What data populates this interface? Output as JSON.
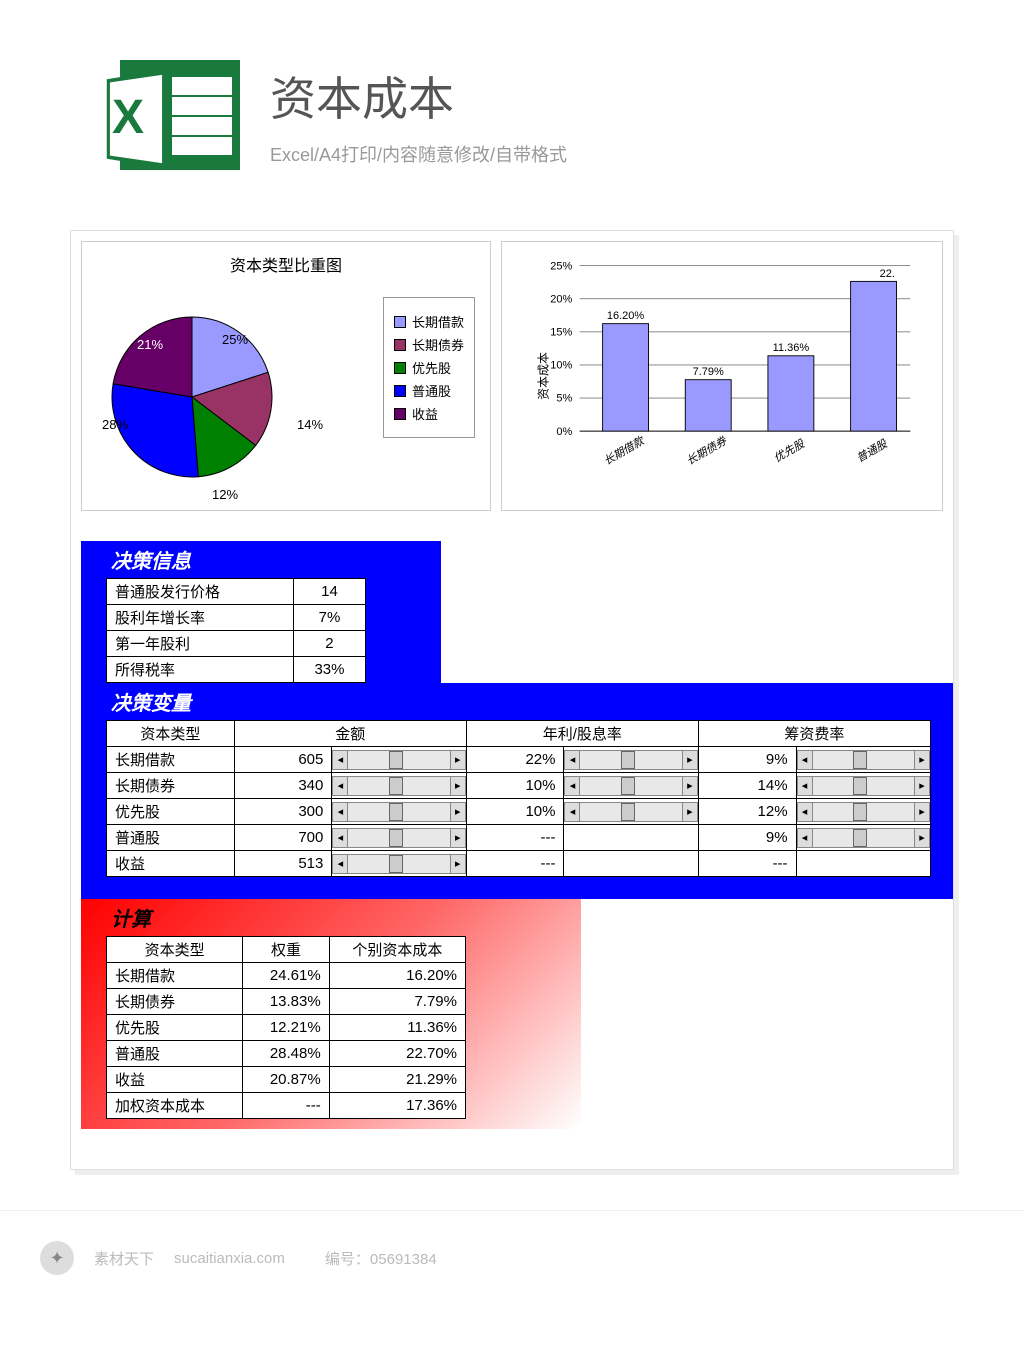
{
  "header": {
    "title": "资本成本",
    "subtitle": "Excel/A4打印/内容随意修改/自带格式"
  },
  "chart_data": [
    {
      "type": "pie",
      "title": "资本类型比重图",
      "series": [
        {
          "name": "长期借款",
          "value": 25,
          "color": "#9999ff"
        },
        {
          "name": "长期债券",
          "value": 14,
          "color": "#993366"
        },
        {
          "name": "优先股",
          "value": 12,
          "color": "#008000"
        },
        {
          "name": "普通股",
          "value": 28,
          "color": "#0000ff"
        },
        {
          "name": "收益",
          "value": 21,
          "color": "#660066"
        }
      ]
    },
    {
      "type": "bar",
      "ylabel": "资本成本",
      "ylim": [
        0,
        25
      ],
      "categories": [
        "长期借款",
        "长期债券",
        "优先股",
        "普通股"
      ],
      "values": [
        16.2,
        7.79,
        11.36,
        22.7
      ],
      "value_labels": [
        "16.20%",
        "7.79%",
        "11.36%",
        "22."
      ],
      "color": "#9999ff"
    }
  ],
  "decision_info": {
    "title": "决策信息",
    "rows": [
      {
        "label": "普通股发行价格",
        "value": "14"
      },
      {
        "label": "股利年增长率",
        "value": "7%"
      },
      {
        "label": "第一年股利",
        "value": "2"
      },
      {
        "label": "所得税率",
        "value": "33%"
      }
    ]
  },
  "decision_var": {
    "title": "决策变量",
    "headers": [
      "资本类型",
      "金额",
      "年利/股息率",
      "筹资费率"
    ],
    "rows": [
      {
        "type": "长期借款",
        "amount": "605",
        "rate": "22%",
        "fee": "9%",
        "sliders": [
          true,
          true,
          true
        ]
      },
      {
        "type": "长期债券",
        "amount": "340",
        "rate": "10%",
        "fee": "14%",
        "sliders": [
          true,
          true,
          true
        ]
      },
      {
        "type": "优先股",
        "amount": "300",
        "rate": "10%",
        "fee": "12%",
        "sliders": [
          true,
          true,
          true
        ]
      },
      {
        "type": "普通股",
        "amount": "700",
        "rate": "---",
        "fee": "9%",
        "sliders": [
          true,
          false,
          true
        ]
      },
      {
        "type": "收益",
        "amount": "513",
        "rate": "---",
        "fee": "---",
        "sliders": [
          true,
          false,
          false
        ]
      }
    ]
  },
  "calculation": {
    "title": "计算",
    "headers": [
      "资本类型",
      "权重",
      "个别资本成本"
    ],
    "rows": [
      {
        "type": "长期借款",
        "weight": "24.61%",
        "cost": "16.20%"
      },
      {
        "type": "长期债券",
        "weight": "13.83%",
        "cost": "7.79%"
      },
      {
        "type": "优先股",
        "weight": "12.21%",
        "cost": "11.36%"
      },
      {
        "type": "普通股",
        "weight": "28.48%",
        "cost": "22.70%"
      },
      {
        "type": "收益",
        "weight": "20.87%",
        "cost": "21.29%"
      },
      {
        "type": "加权资本成本",
        "weight": "---",
        "cost": "17.36%"
      }
    ]
  },
  "footer": {
    "brand": "素材天下",
    "domain": "sucaitianxia.com",
    "id_label": "编号：",
    "id": "05691384"
  }
}
